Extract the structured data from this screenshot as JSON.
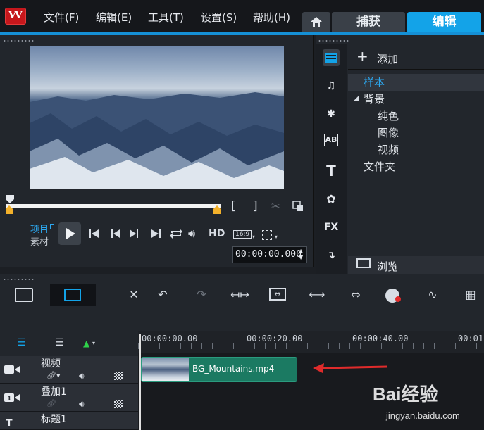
{
  "menu": {
    "items": [
      {
        "label": "文件(F)"
      },
      {
        "label": "编辑(E)"
      },
      {
        "label": "工具(T)"
      },
      {
        "label": "设置(S)"
      },
      {
        "label": "帮助(H)"
      }
    ]
  },
  "tabs": {
    "capture": "捕获",
    "edit": "编辑"
  },
  "player": {
    "project_label": "项目",
    "clip_label": "素材",
    "hd_label": "HD",
    "aspect": "16:9",
    "timecode": "00:00:00.000"
  },
  "library": {
    "add_label": "添加",
    "browse_label": "浏览",
    "tree": [
      {
        "label": "样本",
        "level": 0,
        "selected": true
      },
      {
        "label": "背景",
        "level": 0,
        "expanded": true
      },
      {
        "label": "纯色",
        "level": 1
      },
      {
        "label": "图像",
        "level": 1
      },
      {
        "label": "视频",
        "level": 1
      },
      {
        "label": "文件夹",
        "level": 0
      }
    ],
    "fx_label": "FX"
  },
  "timeline": {
    "ruler": [
      "00:00:00.00",
      "00:00:20.00",
      "00:00:40.00",
      "00:01"
    ],
    "tracks": [
      {
        "name": "视频"
      },
      {
        "name": "叠加1"
      },
      {
        "name": "标题1"
      }
    ],
    "clip": {
      "name": "BG_Mountains.mp4"
    }
  },
  "watermark": {
    "brand": "Bai经验",
    "url": "jingyan.baidu.com"
  },
  "colors": {
    "accent": "#13a3e8",
    "clip": "#1b7a62",
    "trim": "#f3b12b",
    "arrow": "#e02b2b"
  }
}
